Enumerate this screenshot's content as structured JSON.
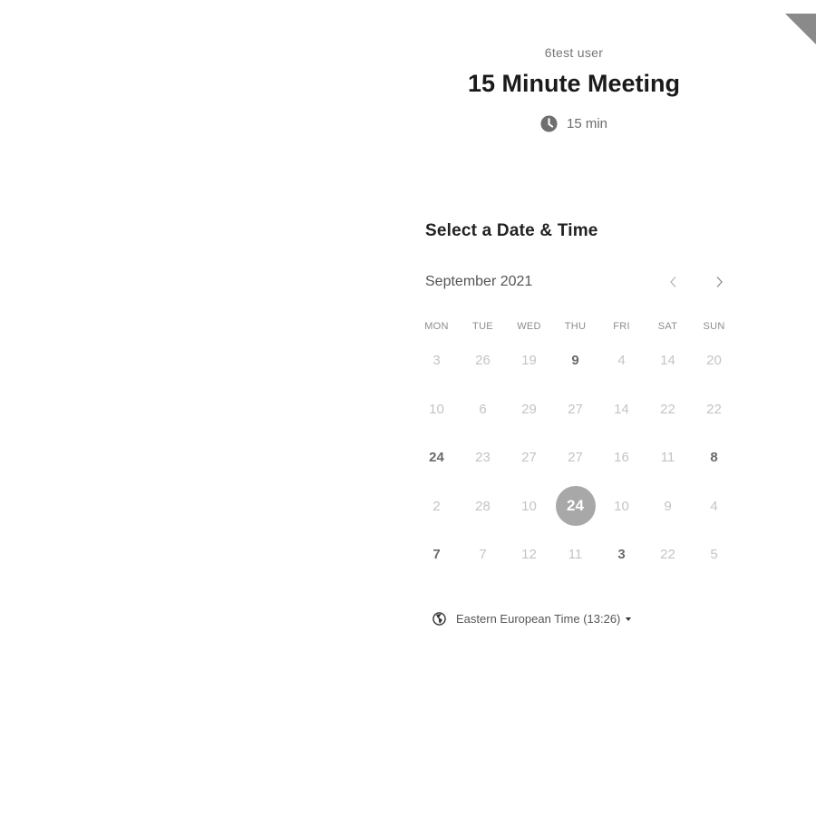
{
  "event": {
    "host": "6test user",
    "title": "15 Minute Meeting",
    "duration": "15 min"
  },
  "scheduler": {
    "section_title": "Select a Date & Time",
    "month": "September 2021",
    "weekdays": [
      "MON",
      "TUE",
      "WED",
      "THU",
      "FRI",
      "SAT",
      "SUN"
    ],
    "weeks": [
      [
        {
          "d": "3",
          "s": "off"
        },
        {
          "d": "26",
          "s": "off"
        },
        {
          "d": "19",
          "s": "off"
        },
        {
          "d": "9",
          "s": "available"
        },
        {
          "d": "4",
          "s": "off"
        },
        {
          "d": "14",
          "s": "off"
        },
        {
          "d": "20",
          "s": "off"
        }
      ],
      [
        {
          "d": "10",
          "s": "off"
        },
        {
          "d": "6",
          "s": "off"
        },
        {
          "d": "29",
          "s": "off"
        },
        {
          "d": "27",
          "s": "off"
        },
        {
          "d": "14",
          "s": "off"
        },
        {
          "d": "22",
          "s": "off"
        },
        {
          "d": "22",
          "s": "off"
        }
      ],
      [
        {
          "d": "24",
          "s": "available"
        },
        {
          "d": "23",
          "s": "off"
        },
        {
          "d": "27",
          "s": "off"
        },
        {
          "d": "27",
          "s": "off"
        },
        {
          "d": "16",
          "s": "off"
        },
        {
          "d": "11",
          "s": "off"
        },
        {
          "d": "8",
          "s": "available"
        }
      ],
      [
        {
          "d": "2",
          "s": "off"
        },
        {
          "d": "28",
          "s": "off"
        },
        {
          "d": "10",
          "s": "off"
        },
        {
          "d": "24",
          "s": "selected"
        },
        {
          "d": "10",
          "s": "off"
        },
        {
          "d": "9",
          "s": "off"
        },
        {
          "d": "4",
          "s": "off"
        }
      ],
      [
        {
          "d": "7",
          "s": "available"
        },
        {
          "d": "7",
          "s": "off"
        },
        {
          "d": "12",
          "s": "off"
        },
        {
          "d": "11",
          "s": "off"
        },
        {
          "d": "3",
          "s": "available"
        },
        {
          "d": "22",
          "s": "off"
        },
        {
          "d": "5",
          "s": "off"
        }
      ]
    ],
    "timezone": "Eastern European Time (13:26)"
  },
  "icons": {
    "duration": "clock-icon",
    "prev_month": "chevron-left-icon",
    "next_month": "chevron-right-icon",
    "timezone": "globe-icon",
    "timezone_dropdown": "caret-down-icon"
  },
  "colors": {
    "selected_day_bg": "#a8a8a8",
    "available_day": "#6a6a6a",
    "unavailable_day": "#c4c4c4",
    "corner_ribbon": "#8a8a8a"
  }
}
